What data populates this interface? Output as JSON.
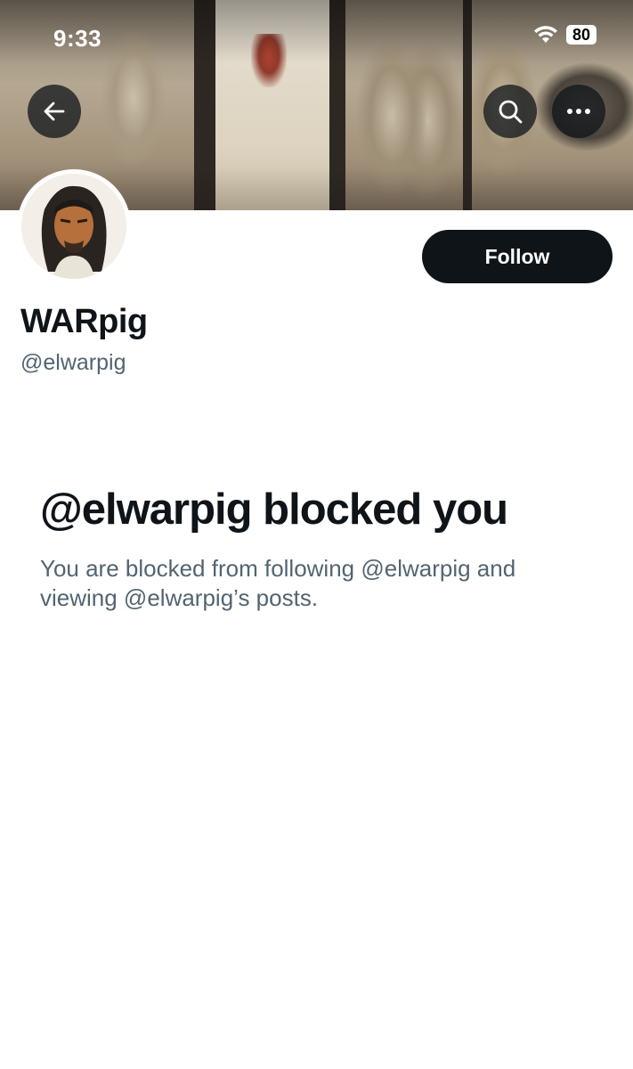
{
  "status_bar": {
    "time": "9:33",
    "battery": "80"
  },
  "header": {
    "banner_icon": "banner-image"
  },
  "profile": {
    "display_name": "WARpig",
    "handle": "@elwarpig",
    "follow_label": "Follow"
  },
  "blocked": {
    "title": "@elwarpig blocked you",
    "description": "You are blocked from following @elwarpig and viewing @elwarpig’s posts."
  },
  "colors": {
    "primary_text": "#0f1419",
    "secondary_text": "#536471",
    "button_bg": "#0f1419",
    "button_text": "#ffffff"
  }
}
